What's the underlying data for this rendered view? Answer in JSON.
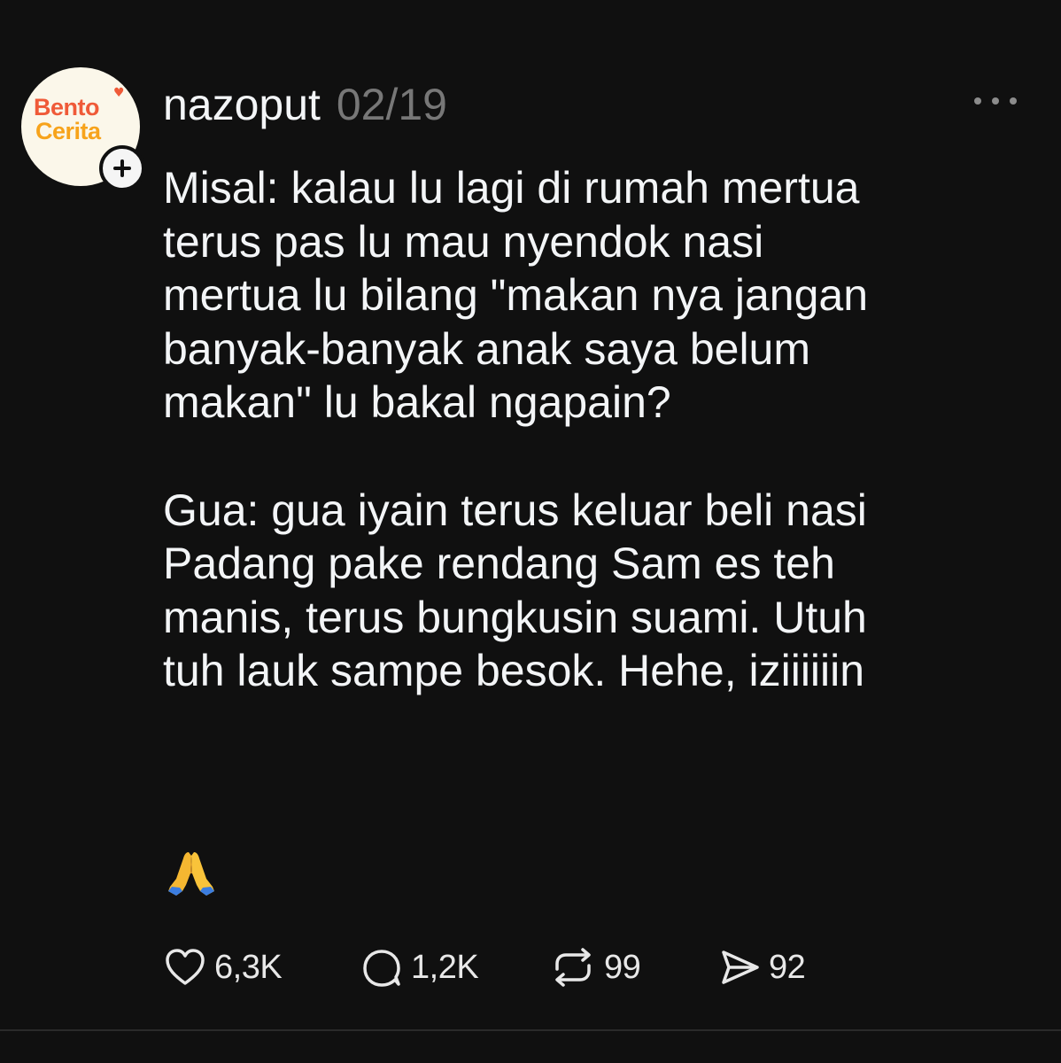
{
  "post": {
    "avatar": {
      "logo_line1": "Bento",
      "logo_line2": "Cerita"
    },
    "username": "nazoput",
    "date": "02/19",
    "paragraphs": [
      "Misal: kalau lu lagi di rumah mertua\nterus pas lu mau nyendok nasi\nmertua lu bilang \"makan nya jangan\nbanyak-banyak anak saya belum\nmakan\" lu bakal ngapain?",
      "Gua: gua iyain terus keluar beli nasi\nPadang pake rendang Sam es teh\nmanis, terus bungkusin suami. Utuh\ntuh lauk sampe besok. Hehe, iziiiiiin"
    ],
    "emoji": "folded-hands-emoji",
    "actions": {
      "likes": "6,3K",
      "replies": "1,2K",
      "reposts": "99",
      "shares": "92"
    }
  },
  "colors": {
    "background": "#101010",
    "text": "#f3f5f7",
    "muted": "#777777",
    "logo_orange_red": "#ef5a38",
    "logo_orange": "#f7a31b"
  }
}
